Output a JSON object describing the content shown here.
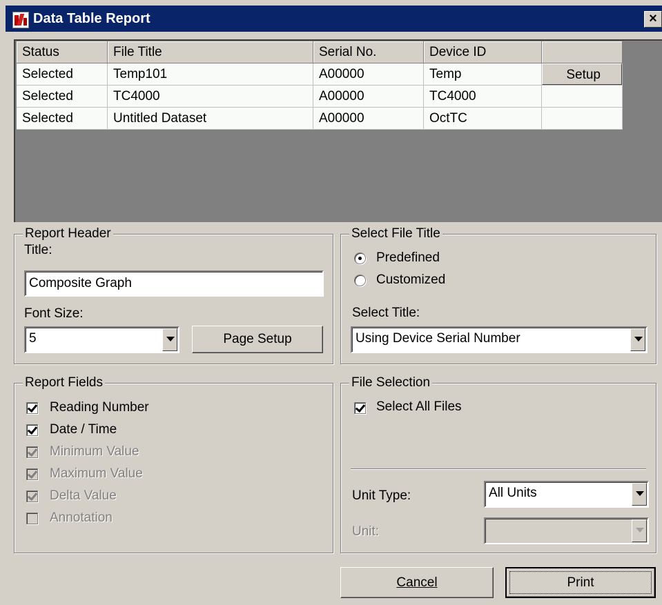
{
  "window": {
    "title": "Data Table Report",
    "close_label": "×"
  },
  "table": {
    "columns": [
      "Status",
      "File Title",
      "Serial No.",
      "Device ID",
      ""
    ],
    "rows": [
      {
        "status": "Selected",
        "file_title": "Temp101",
        "serial": "A00000",
        "device": "Temp",
        "action": "Setup"
      },
      {
        "status": "Selected",
        "file_title": "TC4000",
        "serial": "A00000",
        "device": "TC4000",
        "action": ""
      },
      {
        "status": "Selected",
        "file_title": "Untitled Dataset",
        "serial": "A00000",
        "device": "OctTC",
        "action": ""
      }
    ]
  },
  "report_header": {
    "legend": "Report Header",
    "title_label": "Title:",
    "title_value": "Composite Graph",
    "font_size_label": "Font Size:",
    "font_size_value": "5",
    "page_setup_label": "Page Setup"
  },
  "select_file_title": {
    "legend": "Select File Title",
    "predefined_label": "Predefined",
    "customized_label": "Customized",
    "selected": "Predefined",
    "select_title_label": "Select Title:",
    "select_title_value": "Using Device Serial Number"
  },
  "report_fields": {
    "legend": "Report Fields",
    "items": [
      {
        "label": "Reading Number",
        "checked": true,
        "enabled": true
      },
      {
        "label": "Date / Time",
        "checked": true,
        "enabled": true
      },
      {
        "label": "Minimum Value",
        "checked": true,
        "enabled": false
      },
      {
        "label": "Maximum Value",
        "checked": true,
        "enabled": false
      },
      {
        "label": "Delta Value",
        "checked": true,
        "enabled": false
      },
      {
        "label": "Annotation",
        "checked": false,
        "enabled": false
      }
    ]
  },
  "file_selection": {
    "legend": "File Selection",
    "select_all_label": "Select All Files",
    "select_all_checked": true,
    "unit_type_label": "Unit Type:",
    "unit_type_value": "All Units",
    "unit_label": "Unit:",
    "unit_value": ""
  },
  "buttons": {
    "cancel": "Cancel",
    "print": "Print"
  }
}
